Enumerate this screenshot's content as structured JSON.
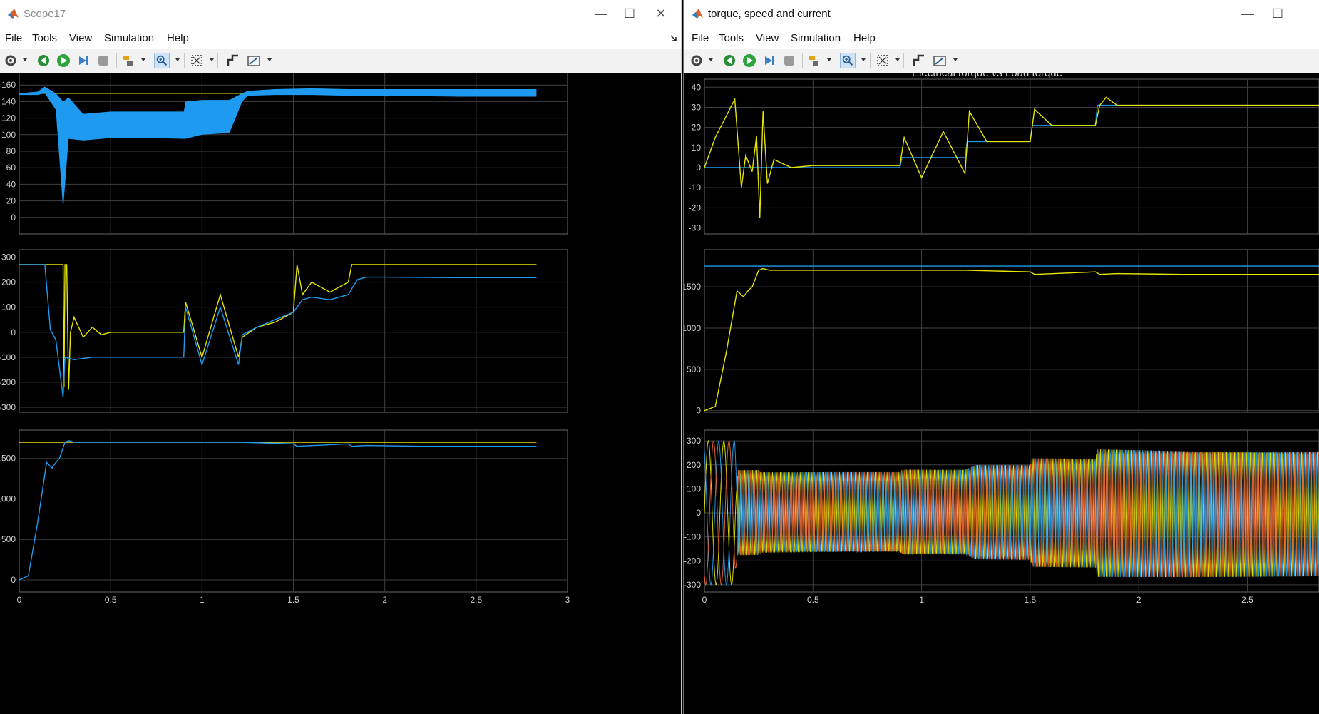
{
  "windows": [
    {
      "title": "Scope17",
      "menu": [
        "File",
        "Tools",
        "View",
        "Simulation",
        "Help"
      ],
      "controls": {
        "minimize": "—",
        "maximize": "☐",
        "close": "✕"
      }
    },
    {
      "title": "torque, speed and current",
      "menu": [
        "File",
        "Tools",
        "View",
        "Simulation",
        "Help"
      ],
      "controls": {
        "minimize": "—",
        "maximize": "☐"
      }
    }
  ],
  "toolbar_icons": [
    "settings-icon",
    "step-back-icon",
    "run-icon",
    "step-forward-icon",
    "stop-icon",
    "highlight-signal-icon",
    "zoom-icon",
    "fit-view-icon",
    "triggers-icon",
    "cursor-measurements-icon"
  ],
  "colors": {
    "axes_bg": "#000000",
    "grid": "#404040",
    "tick_text": "#d0d0d0",
    "series_yellow": "#e6e600",
    "series_blue": "#1e9bf0",
    "series_orange": "#e8632a"
  },
  "chart_data": [
    {
      "type": "line",
      "window": "Scope17",
      "yticks": [
        "160",
        "140",
        "120",
        "100",
        "80",
        "60",
        "40",
        "20",
        "0"
      ],
      "xlim": [
        0,
        3
      ],
      "ylim": [
        -20,
        180
      ],
      "grid": true,
      "series": [
        {
          "color": "yellow",
          "x": [
            0,
            2.83
          ],
          "y": [
            150,
            150
          ]
        },
        {
          "color": "blue",
          "kind": "band",
          "x": [
            0,
            0.1,
            0.14,
            0.2,
            0.24,
            0.27,
            0.35,
            0.5,
            0.7,
            0.9,
            0.91,
            1.0,
            1.15,
            1.22,
            1.25,
            1.4,
            1.6,
            1.8,
            2.0,
            2.4,
            2.83
          ],
          "upper": [
            150,
            152,
            158,
            150,
            140,
            145,
            125,
            128,
            128,
            128,
            140,
            142,
            142,
            150,
            153,
            155,
            156,
            155,
            155,
            155,
            155
          ],
          "lower": [
            148,
            148,
            150,
            130,
            10,
            95,
            93,
            96,
            96,
            95,
            95,
            100,
            102,
            140,
            147,
            148,
            148,
            147,
            147,
            146,
            146
          ]
        }
      ]
    },
    {
      "type": "line",
      "window": "Scope17",
      "yticks": [
        "300",
        "200",
        "100",
        "0",
        "-100",
        "-200",
        "-300"
      ],
      "xlim": [
        0,
        3
      ],
      "ylim": [
        -320,
        330
      ],
      "grid": true,
      "series": [
        {
          "color": "yellow",
          "x": [
            0,
            0.24,
            0.245,
            0.25,
            0.26,
            0.27,
            0.28,
            0.3,
            0.35,
            0.4,
            0.45,
            0.5,
            0.9,
            0.91,
            1.0,
            1.1,
            1.2,
            1.22,
            1.3,
            1.4,
            1.5,
            1.52,
            1.55,
            1.6,
            1.7,
            1.8,
            1.82,
            1.9,
            2.0,
            2.4,
            2.83
          ],
          "y": [
            270,
            270,
            -220,
            270,
            270,
            -230,
            0,
            60,
            -20,
            20,
            -10,
            0,
            0,
            120,
            -100,
            150,
            -100,
            -20,
            20,
            40,
            80,
            270,
            150,
            200,
            160,
            200,
            270,
            270,
            270,
            270,
            270
          ]
        },
        {
          "color": "blue",
          "x": [
            0,
            0.14,
            0.17,
            0.2,
            0.24,
            0.25,
            0.3,
            0.4,
            0.5,
            0.9,
            0.91,
            1.0,
            1.1,
            1.2,
            1.22,
            1.3,
            1.4,
            1.5,
            1.55,
            1.6,
            1.7,
            1.8,
            1.85,
            1.9,
            2.0,
            2.4,
            2.83
          ],
          "y": [
            270,
            270,
            10,
            -30,
            -260,
            -100,
            -110,
            -100,
            -100,
            -100,
            100,
            -130,
            100,
            -130,
            -10,
            20,
            50,
            80,
            130,
            140,
            130,
            150,
            210,
            220,
            220,
            218,
            218
          ]
        }
      ]
    },
    {
      "type": "line",
      "window": "Scope17",
      "yticks": [
        "1500",
        "1000",
        "500",
        "0"
      ],
      "xticks": [
        "0",
        "0.5",
        "1",
        "1.5",
        "2",
        "2.5",
        "3"
      ],
      "xlim": [
        0,
        3
      ],
      "ylim": [
        -150,
        1850
      ],
      "grid": true,
      "series": [
        {
          "color": "yellow",
          "x": [
            0,
            2.83
          ],
          "y": [
            1700,
            1700
          ]
        },
        {
          "color": "blue",
          "x": [
            0,
            0.05,
            0.1,
            0.15,
            0.18,
            0.2,
            0.22,
            0.25,
            0.27,
            0.3,
            0.9,
            1.2,
            1.5,
            1.52,
            1.8,
            1.82,
            1.9,
            2.2,
            2.83
          ],
          "y": [
            0,
            50,
            700,
            1450,
            1380,
            1450,
            1500,
            1700,
            1720,
            1700,
            1700,
            1700,
            1680,
            1650,
            1680,
            1650,
            1660,
            1650,
            1650
          ]
        }
      ]
    },
    {
      "type": "line",
      "window": "torque, speed and current",
      "title": "Electrical torque vs Load torque",
      "yticks": [
        "40",
        "30",
        "20",
        "10",
        "0",
        "-10",
        "-20",
        "-30"
      ],
      "xlim": [
        0,
        2.83
      ],
      "ylim": [
        -33,
        44
      ],
      "grid": true,
      "series": [
        {
          "color": "blue",
          "x": [
            0,
            0.9,
            0.91,
            1.2,
            1.21,
            1.5,
            1.51,
            1.8,
            1.81,
            2.83
          ],
          "y": [
            0,
            0,
            5,
            5,
            13,
            13,
            21,
            21,
            31,
            31
          ]
        },
        {
          "color": "yellow",
          "x": [
            0,
            0.05,
            0.14,
            0.17,
            0.19,
            0.22,
            0.24,
            0.255,
            0.27,
            0.29,
            0.32,
            0.4,
            0.5,
            0.9,
            0.92,
            1.0,
            1.1,
            1.2,
            1.22,
            1.3,
            1.5,
            1.52,
            1.6,
            1.8,
            1.82,
            1.85,
            1.9,
            2.83
          ],
          "y": [
            0,
            15,
            34,
            -10,
            6,
            -2,
            16,
            -25,
            28,
            -8,
            4,
            0,
            1,
            1,
            15,
            -5,
            18,
            -3,
            28,
            13,
            13,
            29,
            21,
            21,
            31,
            35,
            31,
            31
          ]
        }
      ]
    },
    {
      "type": "line",
      "window": "torque, speed and current",
      "yticks": [
        "1500",
        "1000",
        "500",
        "0"
      ],
      "xlim": [
        0,
        2.83
      ],
      "ylim": [
        -20,
        1950
      ],
      "grid": true,
      "series": [
        {
          "color": "blue",
          "x": [
            0,
            2.83
          ],
          "y": [
            1750,
            1750
          ]
        },
        {
          "color": "yellow",
          "x": [
            0,
            0.05,
            0.1,
            0.15,
            0.18,
            0.2,
            0.22,
            0.25,
            0.27,
            0.3,
            0.9,
            1.2,
            1.5,
            1.52,
            1.8,
            1.82,
            1.9,
            2.2,
            2.83
          ],
          "y": [
            0,
            50,
            700,
            1450,
            1380,
            1450,
            1500,
            1700,
            1720,
            1700,
            1700,
            1700,
            1680,
            1650,
            1680,
            1650,
            1660,
            1650,
            1650
          ]
        }
      ]
    },
    {
      "type": "line",
      "window": "torque, speed and current",
      "yticks": [
        "300",
        "200",
        "100",
        "0",
        "-100",
        "-200",
        "-300"
      ],
      "xticks": [
        "0",
        "0.5",
        "1",
        "1.5",
        "2",
        "2.5"
      ],
      "xlim": [
        0,
        2.83
      ],
      "ylim": [
        -330,
        345
      ],
      "grid": true,
      "series": [
        {
          "color": "multi",
          "kind": "envelope",
          "x": [
            0,
            0.14,
            0.15,
            0.25,
            0.26,
            0.9,
            0.91,
            1.2,
            1.25,
            1.5,
            1.51,
            1.8,
            1.81,
            2.83
          ],
          "amplitude": [
            300,
            300,
            180,
            180,
            170,
            170,
            180,
            180,
            200,
            200,
            230,
            230,
            270,
            265
          ]
        }
      ]
    }
  ]
}
